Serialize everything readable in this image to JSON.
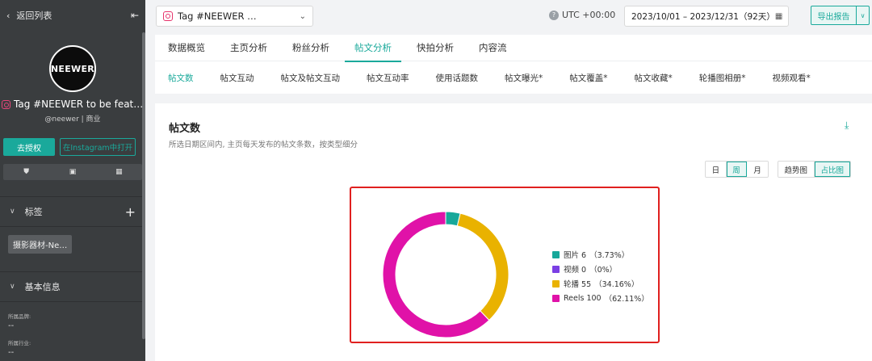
{
  "sidebar": {
    "back_label": "返回列表",
    "logo_text": "NEEWER",
    "account_name": "Tag #NEEWER to be feat…",
    "account_handle": "@neewer | 商业",
    "authorize_label": "去授权",
    "open_ig_label": "在Instagram中打开",
    "tags_label": "标签",
    "tag_chip": "摄影器材-Ne…",
    "basic_info_label": "基本信息",
    "brand_label": "所属品牌:",
    "brand_value": "--",
    "industry_label": "所属行业:",
    "industry_value": "--"
  },
  "topbar": {
    "account_select": "Tag #NEEWER …",
    "timezone": "UTC +00:00",
    "date_range": "2023/10/01 – 2023/12/31（92天）",
    "export_label": "导出报告"
  },
  "main_tabs": [
    {
      "label": "数据概览"
    },
    {
      "label": "主页分析"
    },
    {
      "label": "粉丝分析"
    },
    {
      "label": "帖文分析"
    },
    {
      "label": "快拍分析"
    },
    {
      "label": "内容流"
    }
  ],
  "sub_tabs": [
    {
      "label": "帖文数"
    },
    {
      "label": "帖文互动"
    },
    {
      "label": "帖文及帖文互动"
    },
    {
      "label": "帖文互动率"
    },
    {
      "label": "使用话题数"
    },
    {
      "label": "帖文曝光*"
    },
    {
      "label": "帖文覆盖*"
    },
    {
      "label": "帖文收藏*"
    },
    {
      "label": "轮播图相册*"
    },
    {
      "label": "视频观看*"
    }
  ],
  "card": {
    "title": "帖文数",
    "description": "所选日期区间内, 主页每天发布的帖文条数，按类型细分",
    "period_buttons": [
      "日",
      "周",
      "月"
    ],
    "view_buttons": [
      "趋势图",
      "占比图"
    ]
  },
  "chart_data": {
    "type": "pie",
    "donut": true,
    "slices": [
      {
        "name": "图片",
        "value": 6,
        "percent": "3.73%",
        "color": "#17a89a"
      },
      {
        "name": "视频",
        "value": 0,
        "percent": "0%",
        "color": "#7b3fe4"
      },
      {
        "name": "轮播",
        "value": 55,
        "percent": "34.16%",
        "color": "#e9b200"
      },
      {
        "name": "Reels",
        "value": 100,
        "percent": "62.11%",
        "color": "#e012a8"
      }
    ]
  },
  "colors": {
    "accent": "#1aa99b",
    "highlight": "#e0201f",
    "sidebar_bg": "#3a3d3f"
  }
}
